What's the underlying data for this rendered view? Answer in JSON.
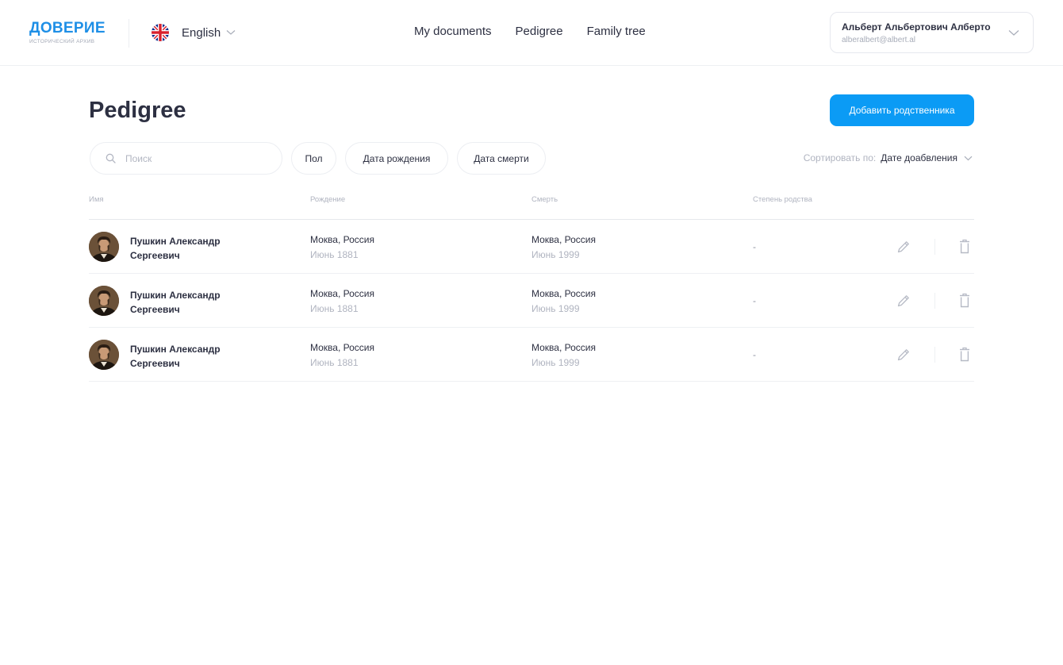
{
  "logo": {
    "title": "ДОВЕРИЕ",
    "subtitle": "ИСТОРИЧЕСКИЙ АРХИВ"
  },
  "language": {
    "label": "English",
    "icon": "uk-flag-icon"
  },
  "nav": {
    "items": [
      {
        "label": "My documents"
      },
      {
        "label": "Pedigree"
      },
      {
        "label": "Family tree"
      }
    ]
  },
  "user": {
    "name": "Альберт Альбертович Алберто",
    "email": "alberalbert@albert.al"
  },
  "page": {
    "title": "Pedigree",
    "add_button": "Добавить родственника"
  },
  "filters": {
    "search_placeholder": "Поиск",
    "gender": "Пол",
    "birth_date": "Дата рождения",
    "death_date": "Дата смерти",
    "sort_label": "Сортировать по:",
    "sort_value": "Дате доабвления"
  },
  "table": {
    "headers": {
      "name": "Имя",
      "birth": "Рождение",
      "death": "Смерть",
      "relation": "Степень родства"
    },
    "rows": [
      {
        "name": "Пушкин Александр Сергеевич",
        "birth_place": "Моква, Россия",
        "birth_date": "Июнь 1881",
        "death_place": "Моква, Россия",
        "death_date": "Июнь 1999",
        "relation": "-"
      },
      {
        "name": "Пушкин Александр Сергеевич",
        "birth_place": "Моква, Россия",
        "birth_date": "Июнь 1881",
        "death_place": "Моква, Россия",
        "death_date": "Июнь 1999",
        "relation": "-"
      },
      {
        "name": "Пушкин Александр Сергеевич",
        "birth_place": "Моква, Россия",
        "birth_date": "Июнь 1881",
        "death_place": "Моква, Россия",
        "death_date": "Июнь 1999",
        "relation": "-"
      }
    ]
  },
  "colors": {
    "brand": "#1e8fe6",
    "accent_button": "#0b9bf5",
    "text": "#2d3042",
    "muted": "#b0b4c0"
  }
}
